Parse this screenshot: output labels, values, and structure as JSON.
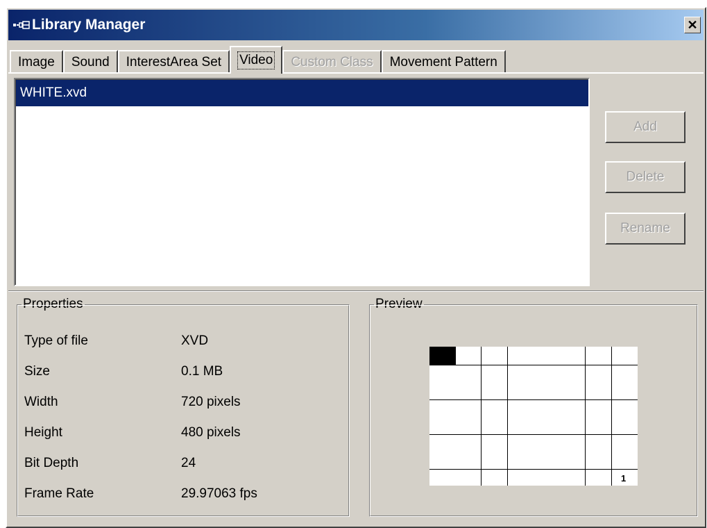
{
  "window": {
    "title": "Library Manager",
    "close_glyph": "✕"
  },
  "tabs": [
    {
      "label": "Image",
      "state": "normal"
    },
    {
      "label": "Sound",
      "state": "normal"
    },
    {
      "label": "InterestArea Set",
      "state": "normal"
    },
    {
      "label": "Video",
      "state": "active"
    },
    {
      "label": "Custom Class",
      "state": "disabled"
    },
    {
      "label": "Movement Pattern",
      "state": "normal"
    }
  ],
  "file_list": {
    "items": [
      {
        "name": "WHITE.xvd",
        "selected": true
      }
    ]
  },
  "buttons": {
    "add": "Add",
    "delete": "Delete",
    "rename": "Rename"
  },
  "properties": {
    "label": "Properties",
    "rows": [
      {
        "key": "Type of file",
        "value": "XVD"
      },
      {
        "key": "Size",
        "value": "0.1 MB"
      },
      {
        "key": "Width",
        "value": "720 pixels"
      },
      {
        "key": "Height",
        "value": "480 pixels"
      },
      {
        "key": "Bit Depth",
        "value": "24"
      },
      {
        "key": "Frame Rate",
        "value": "29.97063 fps"
      }
    ]
  },
  "preview": {
    "label": "Preview",
    "frame_number": "1"
  },
  "colors": {
    "face": "#d4d0c8",
    "title_start": "#0a246a",
    "title_end": "#a6caf0",
    "selection": "#0a246a",
    "disabled_text": "#a0a0a0"
  },
  "icons": {
    "title": "library-manager-app-icon",
    "close": "close-icon"
  }
}
